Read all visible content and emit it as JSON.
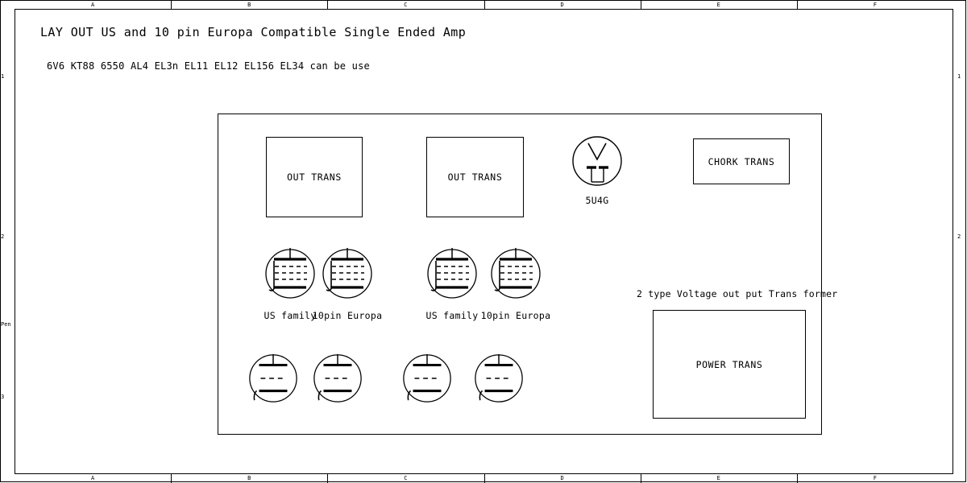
{
  "drawing": {
    "title": "LAY OUT US and 10 pin Europa  Compatible Single Ended Amp",
    "subtitle": "6V6 KT88 6550 AL4 EL3n EL11 EL12 EL156 EL34 can be use",
    "frame": {
      "columns": [
        "A",
        "B",
        "C",
        "D",
        "E",
        "F"
      ],
      "rows_left": [
        "1",
        "2",
        "Pen",
        "3"
      ],
      "rows_right": [
        "1",
        "2"
      ],
      "line_color": "#000000",
      "background": "#ffffff"
    },
    "chassis": {
      "name": "amplifier-chassis-outline"
    },
    "transformers": [
      {
        "label": "OUT TRANS",
        "name": "out-trans-left"
      },
      {
        "label": "OUT TRANS",
        "name": "out-trans-right"
      },
      {
        "label": "CHORK TRANS",
        "name": "chork-trans"
      },
      {
        "label": "POWER TRANS",
        "name": "power-trans"
      }
    ],
    "rectifier": {
      "caption": "5U4G",
      "name": "rectifier-socket-5u4g"
    },
    "socket_row_upper": [
      {
        "caption": "US family",
        "name": "socket-us-family-1"
      },
      {
        "caption": "10pin Europa",
        "name": "socket-10pin-europa-1"
      },
      {
        "caption": "US family",
        "name": "socket-us-family-2"
      },
      {
        "caption": "10pin Europa",
        "name": "socket-10pin-europa-2"
      }
    ],
    "socket_row_lower": [
      {
        "caption": "",
        "name": "socket-preamp-1"
      },
      {
        "caption": "",
        "name": "socket-preamp-2"
      },
      {
        "caption": "",
        "name": "socket-preamp-3"
      },
      {
        "caption": "",
        "name": "socket-preamp-4"
      }
    ],
    "notes": [
      {
        "text": "2 type Voltage out put Trans former",
        "name": "note-voltage-output-transformer"
      }
    ]
  }
}
